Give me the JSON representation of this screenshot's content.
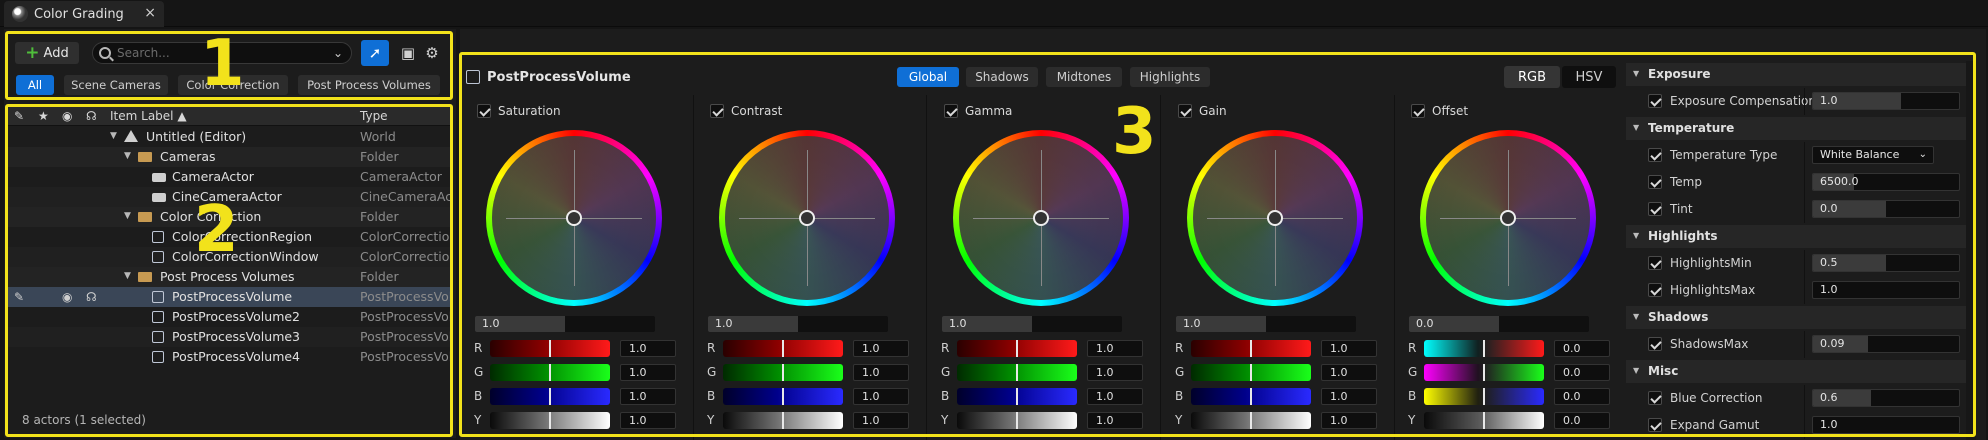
{
  "window": {
    "tab_title": "Color Grading",
    "close_glyph": "×"
  },
  "outliner": {
    "add_label": "Add",
    "search_placeholder": "Search...",
    "filters": [
      "All",
      "Scene Cameras",
      "Color Correction",
      "Post Process Volumes"
    ],
    "columns": {
      "label": "Item Label ▲",
      "type": "Type"
    },
    "rows": [
      {
        "label": "Untitled (Editor)",
        "type": "World"
      },
      {
        "label": "Cameras",
        "type": "Folder"
      },
      {
        "label": "CameraActor",
        "type": "CameraActor"
      },
      {
        "label": "CineCameraActor",
        "type": "CineCameraActor"
      },
      {
        "label": "Color Correction",
        "type": "Folder"
      },
      {
        "label": "ColorCorrectionRegion",
        "type": "ColorCorrection"
      },
      {
        "label": "ColorCorrectionWindow",
        "type": "ColorCorrection"
      },
      {
        "label": "Post Process Volumes",
        "type": "Folder"
      },
      {
        "label": "PostProcessVolume",
        "type": "PostProcessVolume"
      },
      {
        "label": "PostProcessVolume2",
        "type": "PostProcessVolume"
      },
      {
        "label": "PostProcessVolume3",
        "type": "PostProcessVolume"
      },
      {
        "label": "PostProcessVolume4",
        "type": "PostProcessVolume"
      }
    ],
    "footer": "8 actors (1 selected)"
  },
  "grading": {
    "title": "PostProcessVolume",
    "tabs": [
      "Global",
      "Shadows",
      "Midtones",
      "Highlights"
    ],
    "modes": [
      "RGB",
      "HSV"
    ],
    "wheels": [
      {
        "label": "Saturation",
        "master": "1.0",
        "master_level": 0.5,
        "r": "1.0",
        "g": "1.0",
        "b": "1.0",
        "y": "1.0"
      },
      {
        "label": "Contrast",
        "master": "1.0",
        "master_level": 0.5,
        "r": "1.0",
        "g": "1.0",
        "b": "1.0",
        "y": "1.0"
      },
      {
        "label": "Gamma",
        "master": "1.0",
        "master_level": 0.5,
        "r": "1.0",
        "g": "1.0",
        "b": "1.0",
        "y": "1.0"
      },
      {
        "label": "Gain",
        "master": "1.0",
        "master_level": 0.5,
        "r": "1.0",
        "g": "1.0",
        "b": "1.0",
        "y": "1.0"
      },
      {
        "label": "Offset",
        "master": "0.0",
        "master_level": 0.5,
        "r": "0.0",
        "g": "0.0",
        "b": "0.0",
        "y": "0.0"
      }
    ],
    "channel_labels": [
      "R",
      "G",
      "B",
      "Y"
    ]
  },
  "details": {
    "sections": {
      "exposure": "Exposure",
      "temperature": "Temperature",
      "highlights": "Highlights",
      "shadows": "Shadows",
      "misc": "Misc"
    },
    "props": {
      "exposure_compensation": {
        "name": "Exposure Compensation",
        "value": "1.0"
      },
      "temperature_type": {
        "name": "Temperature Type",
        "value": "White Balance"
      },
      "temp": {
        "name": "Temp",
        "value": "6500.0"
      },
      "tint": {
        "name": "Tint",
        "value": "0.0"
      },
      "highlights_min": {
        "name": "HighlightsMin",
        "value": "0.5"
      },
      "highlights_max": {
        "name": "HighlightsMax",
        "value": "1.0"
      },
      "shadows_max": {
        "name": "ShadowsMax",
        "value": "0.09"
      },
      "blue_correction": {
        "name": "Blue Correction",
        "value": "0.6"
      },
      "expand_gamut": {
        "name": "Expand Gamut",
        "value": "1.0"
      }
    }
  },
  "annotations": [
    "1",
    "2",
    "3"
  ],
  "colors": {
    "accent": "#0f6fd6",
    "highlight": "#f2e21b",
    "folder": "#c79a52"
  }
}
